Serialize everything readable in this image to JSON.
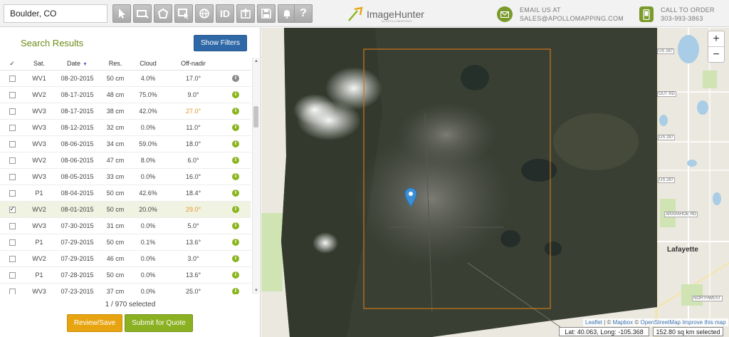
{
  "toolbar": {
    "search": {
      "value": "Boulder, CO",
      "placeholder": ""
    },
    "tools": [
      {
        "name": "pointer-tool",
        "icon": "pointer-icon"
      },
      {
        "name": "rectangle-tool",
        "icon": "rectangle-icon"
      },
      {
        "name": "polygon-tool",
        "icon": "polygon-icon"
      },
      {
        "name": "select-area-tool",
        "icon": "select-area-icon"
      },
      {
        "name": "globe-tool",
        "icon": "globe-icon"
      },
      {
        "name": "id-tool",
        "icon": "id-icon",
        "label": "ID"
      },
      {
        "name": "upload-tool",
        "icon": "upload-icon"
      },
      {
        "name": "save-tool",
        "icon": "save-icon"
      },
      {
        "name": "notify-tool",
        "icon": "bell-icon"
      },
      {
        "name": "help-tool",
        "icon": "help-icon",
        "label": "?"
      }
    ]
  },
  "logo": {
    "text": "ImageHunter",
    "sub": "by APOLLOMAPPING"
  },
  "contact": {
    "email_label": "EMAIL US AT",
    "email": "SALES@APOLLOMAPPING.COM",
    "phone_label": "CALL TO ORDER",
    "phone": "303-993-3863"
  },
  "panel": {
    "title": "Search Results",
    "filters_button": "Show Filters",
    "collapse": "«",
    "columns": [
      "✓",
      "Sat.",
      "Date",
      "Res.",
      "Cloud",
      "Off-nadir",
      ""
    ],
    "rows": [
      {
        "checked": false,
        "sat": "WV1",
        "date": "08-20-2015",
        "res": "50 cm",
        "cloud": "4.0%",
        "offnadir": "17.0°",
        "warn": false,
        "info": "grey"
      },
      {
        "checked": false,
        "sat": "WV2",
        "date": "08-17-2015",
        "res": "48 cm",
        "cloud": "75.0%",
        "offnadir": "9.0°",
        "warn": false,
        "info": "green"
      },
      {
        "checked": false,
        "sat": "WV3",
        "date": "08-17-2015",
        "res": "38 cm",
        "cloud": "42.0%",
        "offnadir": "27.0°",
        "warn": true,
        "info": "green"
      },
      {
        "checked": false,
        "sat": "WV3",
        "date": "08-12-2015",
        "res": "32 cm",
        "cloud": "0.0%",
        "offnadir": "11.0°",
        "warn": false,
        "info": "green"
      },
      {
        "checked": false,
        "sat": "WV3",
        "date": "08-06-2015",
        "res": "34 cm",
        "cloud": "59.0%",
        "offnadir": "18.0°",
        "warn": false,
        "info": "green"
      },
      {
        "checked": false,
        "sat": "WV2",
        "date": "08-06-2015",
        "res": "47 cm",
        "cloud": "8.0%",
        "offnadir": "6.0°",
        "warn": false,
        "info": "green"
      },
      {
        "checked": false,
        "sat": "WV3",
        "date": "08-05-2015",
        "res": "33 cm",
        "cloud": "0.0%",
        "offnadir": "16.0°",
        "warn": false,
        "info": "green"
      },
      {
        "checked": false,
        "sat": "P1",
        "date": "08-04-2015",
        "res": "50 cm",
        "cloud": "42.6%",
        "offnadir": "18.4°",
        "warn": false,
        "info": "green"
      },
      {
        "checked": true,
        "sat": "WV2",
        "date": "08-01-2015",
        "res": "50 cm",
        "cloud": "20.0%",
        "offnadir": "29.0°",
        "warn": true,
        "info": "green"
      },
      {
        "checked": false,
        "sat": "WV3",
        "date": "07-30-2015",
        "res": "31 cm",
        "cloud": "0.0%",
        "offnadir": "5.0°",
        "warn": false,
        "info": "green"
      },
      {
        "checked": false,
        "sat": "P1",
        "date": "07-29-2015",
        "res": "50 cm",
        "cloud": "0.1%",
        "offnadir": "13.6°",
        "warn": false,
        "info": "green"
      },
      {
        "checked": false,
        "sat": "WV2",
        "date": "07-29-2015",
        "res": "46 cm",
        "cloud": "0.0%",
        "offnadir": "3.0°",
        "warn": false,
        "info": "green"
      },
      {
        "checked": false,
        "sat": "P1",
        "date": "07-28-2015",
        "res": "50 cm",
        "cloud": "0.0%",
        "offnadir": "13.6°",
        "warn": false,
        "info": "green"
      },
      {
        "checked": false,
        "sat": "WV3",
        "date": "07-23-2015",
        "res": "37 cm",
        "cloud": "0.0%",
        "offnadir": "25.0°",
        "warn": false,
        "info": "green"
      }
    ],
    "selected_count": "1 / 970 selected",
    "review_button": "Review/Save",
    "quote_button": "Submit for Quote"
  },
  "map": {
    "zoom_in": "+",
    "zoom_out": "−",
    "attribution": {
      "leaflet": "Leaflet",
      "sep1": " | © ",
      "mapbox": "Mapbox",
      "sep2": " © ",
      "osm": "OpenStreetMap",
      "improve": " Improve this map"
    },
    "coords": "Lat: 40.063, Long: -105.368",
    "area": "152.80 sq km selected",
    "labels": {
      "us287_top": "US 287",
      "out_rd": "OUT RD",
      "us287_a": "US 287",
      "us287_b": "US 287",
      "arapahoe": "ARAPAHOE RD",
      "northwest": "NORTHWEST",
      "town": "Lafayette"
    },
    "colors": {
      "aoi": "#c9761c",
      "pin": "#3a8fd6",
      "imagery": "#3a3f34"
    }
  }
}
